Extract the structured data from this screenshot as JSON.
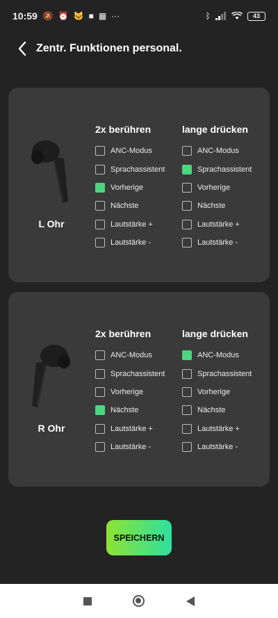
{
  "status_bar": {
    "time": "10:59",
    "more": "···",
    "battery": "43"
  },
  "header": {
    "title": "Zentr. Funktionen personal."
  },
  "colors": {
    "checked": "#4cd680",
    "card": "#3a3a3a",
    "background": "#232323"
  },
  "cards": [
    {
      "label": "L Ohr",
      "col1_title": "2x berühren",
      "col2_title": "lange drücken",
      "options": [
        "ANC-Modus",
        "Sprachassistent",
        "Vorherige",
        "Nächste",
        "Lautstärke +",
        "Lautstärke -"
      ],
      "col1_checked": [
        false,
        false,
        true,
        false,
        false,
        false
      ],
      "col2_checked": [
        false,
        true,
        false,
        false,
        false,
        false
      ]
    },
    {
      "label": "R Ohr",
      "col1_title": "2x berühren",
      "col2_title": "lange drücken",
      "options": [
        "ANC-Modus",
        "Sprachassistent",
        "Vorherige",
        "Nächste",
        "Lautstärke +",
        "Lautstärke -"
      ],
      "col1_checked": [
        false,
        false,
        false,
        true,
        false,
        false
      ],
      "col2_checked": [
        true,
        false,
        false,
        false,
        false,
        false
      ]
    }
  ],
  "save_button": {
    "label": "SPEICHERN"
  },
  "nav_icons": [
    "recents-square-icon",
    "home-circle-icon",
    "back-triangle-icon"
  ]
}
